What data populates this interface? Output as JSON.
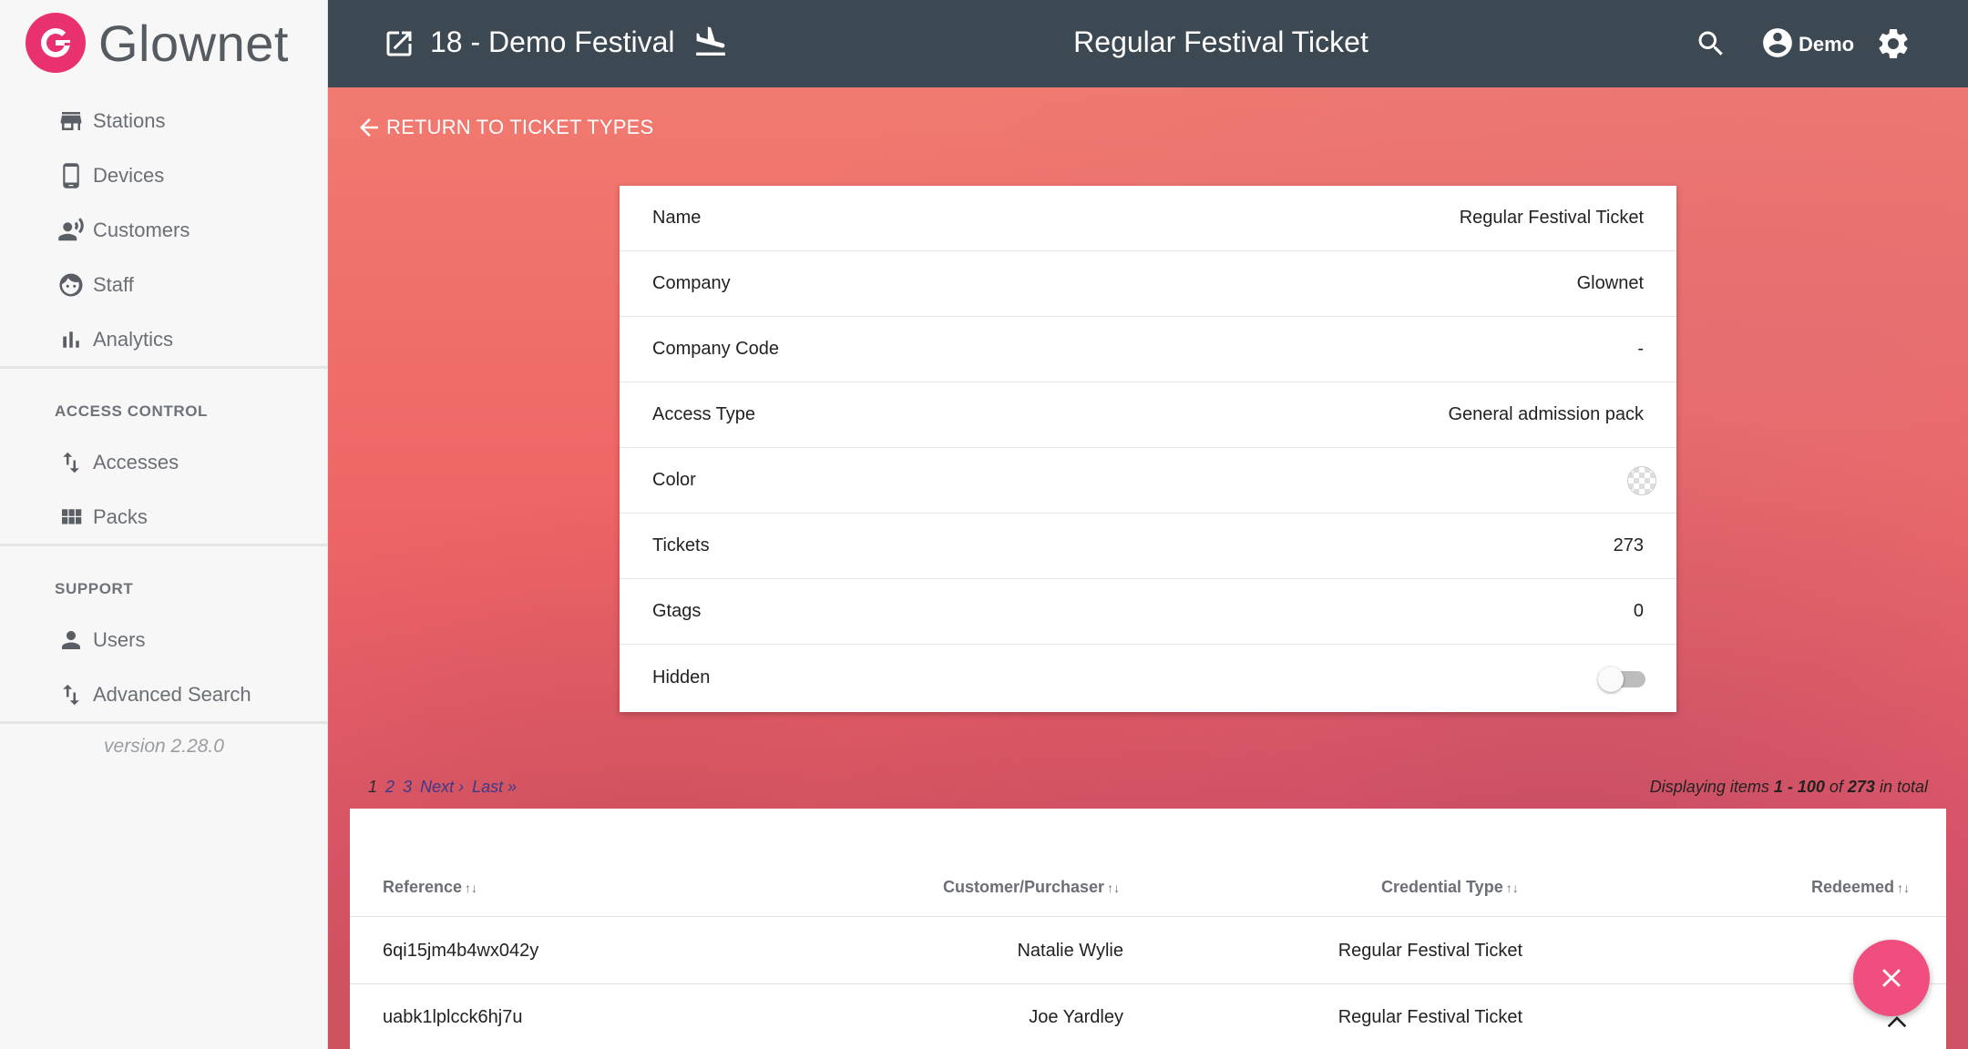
{
  "brand": {
    "name": "Glownet",
    "accent": "#e8316e"
  },
  "sidebar": {
    "main_items": [
      {
        "label": "Stations",
        "icon": "store-icon"
      },
      {
        "label": "Devices",
        "icon": "phone-icon"
      },
      {
        "label": "Customers",
        "icon": "customers-icon"
      },
      {
        "label": "Staff",
        "icon": "face-icon"
      },
      {
        "label": "Analytics",
        "icon": "bar-chart-icon"
      }
    ],
    "access_control": {
      "title": "ACCESS CONTROL",
      "items": [
        {
          "label": "Accesses",
          "icon": "swap-vert-icon"
        },
        {
          "label": "Packs",
          "icon": "grid-icon"
        }
      ]
    },
    "support": {
      "title": "SUPPORT",
      "items": [
        {
          "label": "Users",
          "icon": "person-icon"
        },
        {
          "label": "Advanced Search",
          "icon": "swap-vert-icon"
        }
      ]
    },
    "version": "version 2.28.0"
  },
  "header": {
    "event_title": "18 - Demo Festival",
    "page_title": "Regular Festival Ticket",
    "user_name": "Demo",
    "bg_color": "#3c4852"
  },
  "return_link": "RETURN TO TICKET TYPES",
  "details": {
    "rows": [
      {
        "label": "Name",
        "value": "Regular Festival Ticket"
      },
      {
        "label": "Company",
        "value": "Glownet"
      },
      {
        "label": "Company Code",
        "value": "-"
      },
      {
        "label": "Access Type",
        "value": "General admission pack"
      },
      {
        "label": "Color",
        "value": ""
      },
      {
        "label": "Tickets",
        "value": "273"
      },
      {
        "label": "Gtags",
        "value": "0"
      },
      {
        "label": "Hidden",
        "value": ""
      }
    ],
    "hidden_toggle_on": false
  },
  "pagination": {
    "current": "1",
    "pages": [
      "2",
      "3"
    ],
    "next": "Next ›",
    "last": "Last »"
  },
  "display_info": {
    "prefix": "Displaying items ",
    "range": "1 - 100",
    "of": " of ",
    "total": "273",
    "suffix": " in total"
  },
  "table": {
    "columns": [
      "Reference",
      "Customer/Purchaser",
      "Credential Type",
      "Redeemed"
    ],
    "sort_glyph": "↑↓",
    "rows": [
      {
        "reference": "6qi15jm4b4wx042y",
        "customer": "Natalie Wylie",
        "credential_type": "Regular Festival Ticket",
        "redeemed": ""
      },
      {
        "reference": "uabk1lplcck6hj7u",
        "customer": "Joe Yardley",
        "credential_type": "Regular Festival Ticket",
        "redeemed": ""
      }
    ]
  },
  "fab_color": "#ef4e7f"
}
